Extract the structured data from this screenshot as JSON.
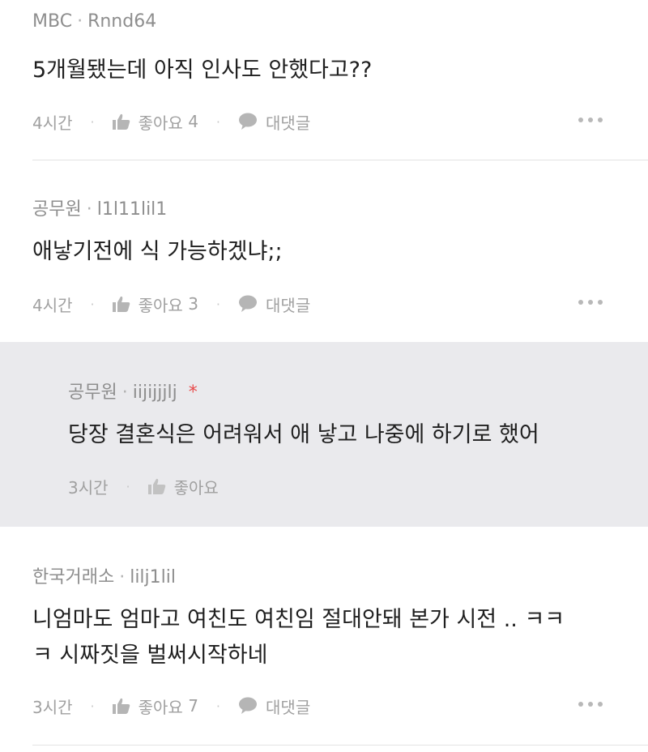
{
  "comments": [
    {
      "group": "MBC",
      "author": "Rnnd64",
      "text": "5개월됐는데 아직 인사도 안했다고??",
      "time": "4시간",
      "like_label": "좋아요",
      "like_count": "4",
      "reply_label": "대댓글"
    },
    {
      "group": "공무원",
      "author": "l1l11lil1",
      "text": "애낳기전에 식 가능하겠냐;;",
      "time": "4시간",
      "like_label": "좋아요",
      "like_count": "3",
      "reply_label": "대댓글"
    },
    {
      "group": "공무원",
      "author": "iijijjjlj",
      "flag": "*",
      "text": "당장 결혼식은 어려워서 애 낳고 나중에 하기로 했어",
      "time": "3시간",
      "like_label": "좋아요"
    },
    {
      "group": "한국거래소",
      "author": "lilj1lil",
      "text_line1": "니엄마도 엄마고 여친도 여친임 절대안돼 본가 시전 .. ㅋㅋ",
      "text_line2": "ㅋ 시짜짓을 벌써시작하네",
      "time": "3시간",
      "like_label": "좋아요",
      "like_count": "7",
      "reply_label": "대댓글"
    }
  ]
}
